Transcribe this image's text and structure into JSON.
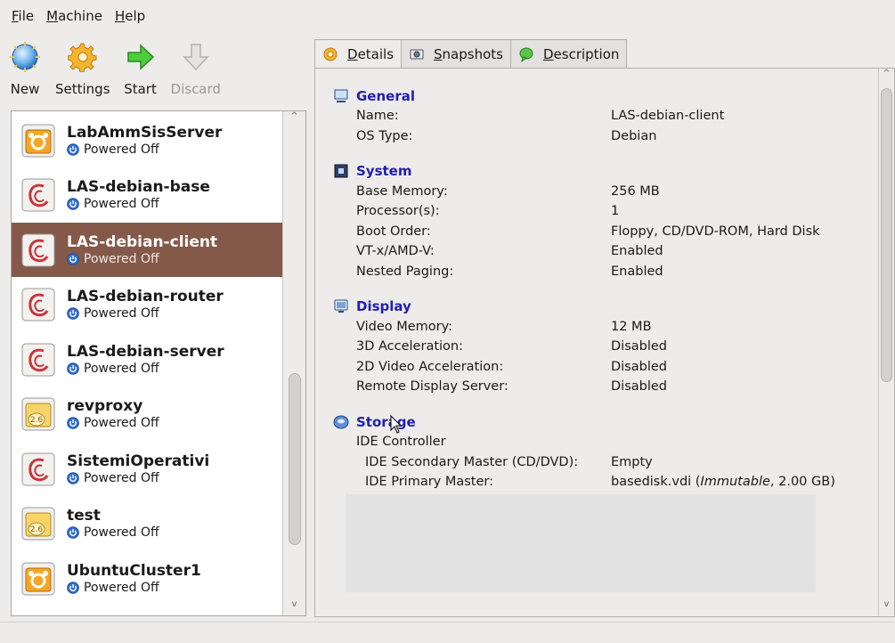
{
  "menu": [
    {
      "label": "File"
    },
    {
      "label": "Machine"
    },
    {
      "label": "Help"
    }
  ],
  "toolbar": {
    "new_label": "New",
    "settings_label": "Settings",
    "start_label": "Start",
    "discard_label": "Discard"
  },
  "vms": [
    {
      "name": "LabAmmSisServer",
      "status": "Powered Off",
      "os_icon": "ubuntu-icon",
      "selected": false
    },
    {
      "name": "LAS-debian-base",
      "status": "Powered Off",
      "os_icon": "debian-icon",
      "selected": false
    },
    {
      "name": "LAS-debian-client",
      "status": "Powered Off",
      "os_icon": "debian-icon",
      "selected": true
    },
    {
      "name": "LAS-debian-router",
      "status": "Powered Off",
      "os_icon": "debian-icon",
      "selected": false
    },
    {
      "name": "LAS-debian-server",
      "status": "Powered Off",
      "os_icon": "debian-icon",
      "selected": false
    },
    {
      "name": "revproxy",
      "status": "Powered Off",
      "os_icon": "linux26-icon",
      "selected": false
    },
    {
      "name": "SistemiOperativi",
      "status": "Powered Off",
      "os_icon": "debian-icon",
      "selected": false
    },
    {
      "name": "test",
      "status": "Powered Off",
      "os_icon": "linux26-icon",
      "selected": false
    },
    {
      "name": "UbuntuCluster1",
      "status": "Powered Off",
      "os_icon": "ubuntu-icon",
      "selected": false
    }
  ],
  "tabs": {
    "details": "Details",
    "snapshots": "Snapshots",
    "description": "Description"
  },
  "details": {
    "general": {
      "title": "General",
      "name_key": "Name:",
      "name_val": "LAS-debian-client",
      "os_key": "OS Type:",
      "os_val": "Debian"
    },
    "system": {
      "title": "System",
      "mem_key": "Base Memory:",
      "mem_val": "256 MB",
      "cpu_key": "Processor(s):",
      "cpu_val": "1",
      "boot_key": "Boot Order:",
      "boot_val": "Floppy, CD/DVD-ROM, Hard Disk",
      "vtx_key": "VT-x/AMD-V:",
      "vtx_val": "Enabled",
      "np_key": "Nested Paging:",
      "np_val": "Enabled"
    },
    "display": {
      "title": "Display",
      "vmem_key": "Video Memory:",
      "vmem_val": "12 MB",
      "acc3d_key": "3D Acceleration:",
      "acc3d_val": "Disabled",
      "acc2d_key": "2D Video Acceleration:",
      "acc2d_val": "Disabled",
      "rds_key": "Remote Display Server:",
      "rds_val": "Disabled"
    },
    "storage": {
      "title": "Storage",
      "controller": "IDE Controller",
      "sec_key": "IDE Secondary Master (CD/DVD):",
      "sec_val": "Empty",
      "pri_key": "IDE Primary Master:",
      "pri_val_file": "basedisk.vdi (",
      "pri_val_type": "Immutable",
      "pri_val_size": ", 2.00 GB)"
    }
  },
  "colors": {
    "selection": "#85594a",
    "section_title": "#1f1fb0",
    "power_icon": "#2f6fcf"
  }
}
